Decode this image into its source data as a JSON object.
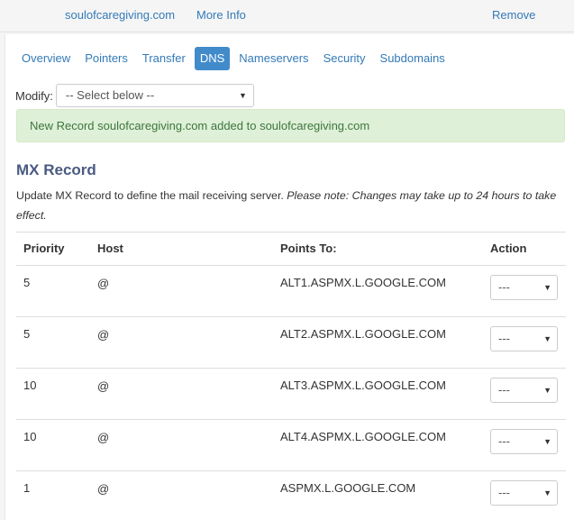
{
  "topbar": {
    "domain": "soulofcaregiving.com",
    "more_info": "More Info",
    "remove": "Remove"
  },
  "tabs": [
    {
      "label": "Overview",
      "active": false
    },
    {
      "label": "Pointers",
      "active": false
    },
    {
      "label": "Transfer",
      "active": false
    },
    {
      "label": "DNS",
      "active": true
    },
    {
      "label": "Nameservers",
      "active": false
    },
    {
      "label": "Security",
      "active": false
    },
    {
      "label": "Subdomains",
      "active": false
    }
  ],
  "modify": {
    "label": "Modify:",
    "selected": "-- Select below --"
  },
  "alert": {
    "message": "New Record soulofcaregiving.com added to soulofcaregiving.com"
  },
  "section": {
    "title": "MX Record",
    "description": "Update MX Record to define the mail receiving server.",
    "note": "Please note: Changes may take up to 24 hours to take effect."
  },
  "table": {
    "headers": {
      "priority": "Priority",
      "host": "Host",
      "points_to": "Points To:",
      "action": "Action"
    },
    "rows": [
      {
        "priority": "5",
        "host": "@",
        "points_to": "ALT1.ASPMX.L.GOOGLE.COM",
        "action": "---"
      },
      {
        "priority": "5",
        "host": "@",
        "points_to": "ALT2.ASPMX.L.GOOGLE.COM",
        "action": "---"
      },
      {
        "priority": "10",
        "host": "@",
        "points_to": "ALT3.ASPMX.L.GOOGLE.COM",
        "action": "---"
      },
      {
        "priority": "10",
        "host": "@",
        "points_to": "ALT4.ASPMX.L.GOOGLE.COM",
        "action": "---"
      },
      {
        "priority": "1",
        "host": "@",
        "points_to": "ASPMX.L.GOOGLE.COM",
        "action": "---"
      }
    ]
  },
  "colors": {
    "link": "#337ab7",
    "active_tab": "#428bca",
    "alert_bg": "#dff0d8",
    "alert_text": "#3c763d",
    "title": "#4a5a82"
  }
}
